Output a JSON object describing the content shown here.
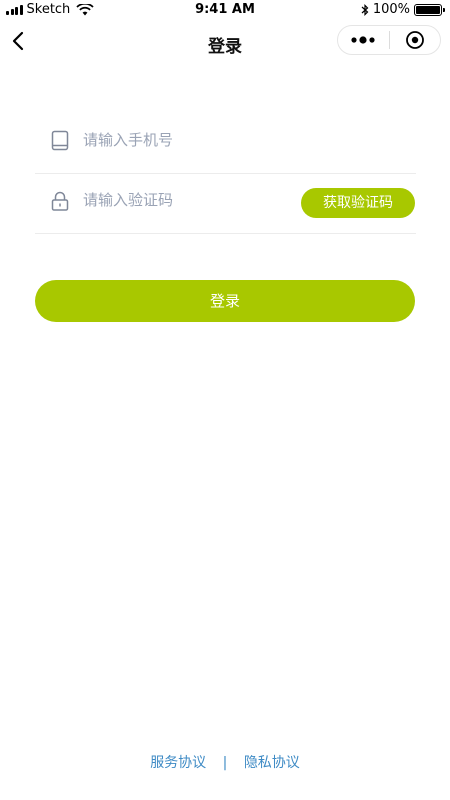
{
  "status_bar": {
    "carrier": "Sketch",
    "time": "9:41 AM",
    "battery_pct": "100%",
    "battery_level": 1.0
  },
  "nav": {
    "back_icon": "chevron-left-icon",
    "title": "登录",
    "capsule_more_icon": "more-dots-icon",
    "capsule_close_icon": "target-circle-icon"
  },
  "form": {
    "phone": {
      "icon": "tablet-icon",
      "placeholder": "请输入手机号",
      "value": ""
    },
    "code": {
      "icon": "lock-icon",
      "placeholder": "请输入验证码",
      "value": "",
      "send_button": "获取验证码"
    },
    "login_button": "登录"
  },
  "footer": {
    "service_agreement": "服务协议",
    "separator": "|",
    "privacy_agreement": "隐私协议"
  },
  "colors": {
    "accent": "#a8c800",
    "link": "#3f8bc5",
    "placeholder": "#9aa3b5",
    "icon": "#7f8798"
  }
}
